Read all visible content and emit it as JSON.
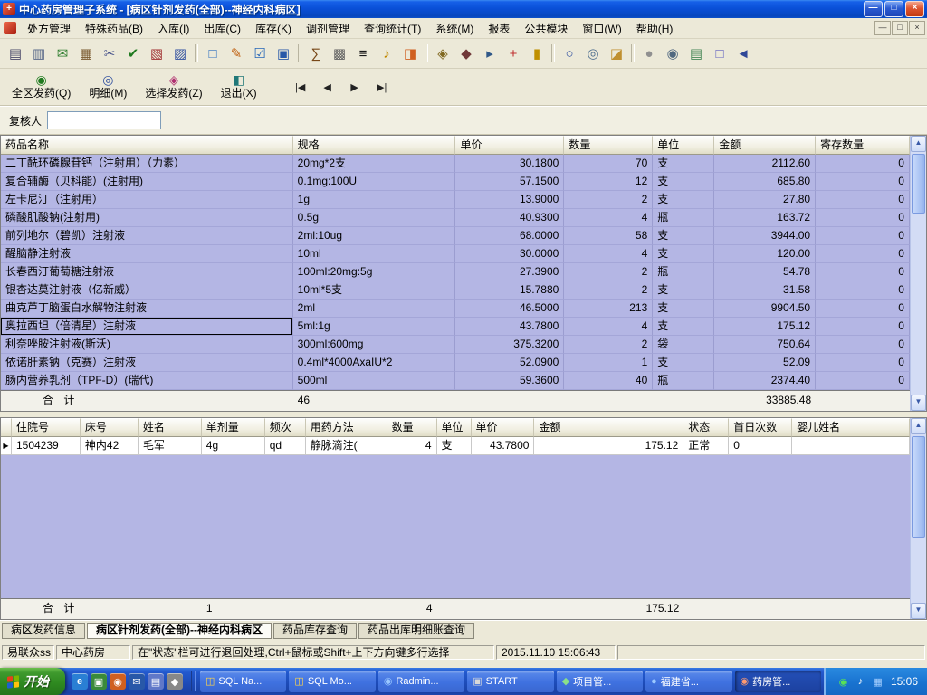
{
  "window": {
    "title": "中心药房管理子系统 - [病区针剂发药(全部)--神经内科病区]",
    "minimize": "—",
    "maximize": "□",
    "close": "×"
  },
  "menubar": {
    "items": [
      "处方管理",
      "特殊药品(B)",
      "入库(I)",
      "出库(C)",
      "库存(K)",
      "调剂管理",
      "查询统计(T)",
      "系统(M)",
      "报表",
      "公共模块",
      "窗口(W)",
      "帮助(H)"
    ],
    "mdi": {
      "minimize": "—",
      "restore": "□",
      "close": "×"
    }
  },
  "toolbar": {
    "groups": [
      [
        {
          "name": "printer-icon",
          "glyph": "▤",
          "color": "#4a4a6a"
        },
        {
          "name": "print-preview-icon",
          "glyph": "▥",
          "color": "#5a6a8a"
        },
        {
          "name": "mail-send-icon",
          "glyph": "✉",
          "color": "#2d7d2d"
        },
        {
          "name": "ledger-icon",
          "glyph": "▦",
          "color": "#7a5a30"
        },
        {
          "name": "scissors-icon",
          "glyph": "✂",
          "color": "#44508a"
        },
        {
          "name": "approve-icon",
          "glyph": "✔",
          "color": "#1f7a1f"
        },
        {
          "name": "red-ledger-icon",
          "glyph": "▧",
          "color": "#a03030"
        },
        {
          "name": "blue-ledger-icon",
          "glyph": "▨",
          "color": "#3050a0"
        }
      ],
      [
        {
          "name": "doc-new-icon",
          "glyph": "□",
          "color": "#3070c0"
        },
        {
          "name": "doc-edit-icon",
          "glyph": "✎",
          "color": "#c06010"
        },
        {
          "name": "doc-audit-icon",
          "glyph": "☑",
          "color": "#2868b8"
        },
        {
          "name": "doc-save-icon",
          "glyph": "▣",
          "color": "#2858a8"
        }
      ],
      [
        {
          "name": "sum-report-icon",
          "glyph": "∑",
          "color": "#784818"
        },
        {
          "name": "report-grid-icon",
          "glyph": "▩",
          "color": "#606060"
        },
        {
          "name": "barcode-icon",
          "glyph": "≡",
          "color": "#181818"
        },
        {
          "name": "alarm-icon",
          "glyph": "♪",
          "color": "#c08800"
        },
        {
          "name": "orange-panel-icon",
          "glyph": "◨",
          "color": "#d06020"
        }
      ],
      [
        {
          "name": "key-icon",
          "glyph": "◈",
          "color": "#806820"
        },
        {
          "name": "lock-icon",
          "glyph": "◆",
          "color": "#703838"
        },
        {
          "name": "transport-icon",
          "glyph": "▸",
          "color": "#305888"
        },
        {
          "name": "medicine-box-icon",
          "glyph": "+",
          "color": "#c03030"
        },
        {
          "name": "thermometer-icon",
          "glyph": "▮",
          "color": "#c09000"
        }
      ],
      [
        {
          "name": "search-icon",
          "glyph": "○",
          "color": "#3050a0"
        },
        {
          "name": "zoom-grid-icon",
          "glyph": "◎",
          "color": "#507090"
        },
        {
          "name": "folder-open-icon",
          "glyph": "◪",
          "color": "#c09030"
        }
      ],
      [
        {
          "name": "globe-icon",
          "glyph": "●",
          "color": "#909090"
        },
        {
          "name": "magnifier-icon",
          "glyph": "◉",
          "color": "#506880"
        },
        {
          "name": "layout-icon",
          "glyph": "▤",
          "color": "#488858"
        },
        {
          "name": "export-icon",
          "glyph": "□",
          "color": "#6060c0"
        },
        {
          "name": "back-icon",
          "glyph": "◄",
          "color": "#304898"
        }
      ]
    ]
  },
  "actionbar": {
    "buttons": [
      {
        "name": "dispense-all-button",
        "icon": "pills-icon",
        "glyph": "◉",
        "color": "#1f7a1f",
        "label": "全区发药(Q)"
      },
      {
        "name": "detail-button",
        "icon": "detail-magnifier-icon",
        "glyph": "◎",
        "color": "#3050a0",
        "label": "明细(M)"
      },
      {
        "name": "select-dispense-button",
        "icon": "select-pills-icon",
        "glyph": "◈",
        "color": "#b03070",
        "label": "选择发药(Z)"
      },
      {
        "name": "exit-button",
        "icon": "exit-door-icon",
        "glyph": "◧",
        "color": "#207878",
        "label": "退出(X)"
      }
    ],
    "nav": [
      {
        "name": "nav-first-button",
        "glyph": "|◀"
      },
      {
        "name": "nav-prev-button",
        "glyph": "◀"
      },
      {
        "name": "nav-next-button",
        "glyph": "▶"
      },
      {
        "name": "nav-last-button",
        "glyph": "▶|"
      }
    ]
  },
  "reviewer": {
    "label": "复核人",
    "value": ""
  },
  "main_table": {
    "columns": [
      "药品名称",
      "规格",
      "单价",
      "数量",
      "单位",
      "金额",
      "寄存数量"
    ],
    "rows": [
      [
        "二丁酰环磷腺苷钙（注射用）（力素）",
        "20mg*2支",
        "30.1800",
        "70",
        "支",
        "2112.60",
        "0"
      ],
      [
        "复合辅酶（贝科能）(注射用)",
        "0.1mg:100U",
        "57.1500",
        "12",
        "支",
        "685.80",
        "0"
      ],
      [
        "左卡尼汀（注射用）",
        "1g",
        "13.9000",
        "2",
        "支",
        "27.80",
        "0"
      ],
      [
        "磷酸肌酸钠(注射用)",
        "0.5g",
        "40.9300",
        "4",
        "瓶",
        "163.72",
        "0"
      ],
      [
        "前列地尔（碧凯）注射液",
        "2ml:10ug",
        "68.0000",
        "58",
        "支",
        "3944.00",
        "0"
      ],
      [
        "醒脑静注射液",
        "10ml",
        "30.0000",
        "4",
        "支",
        "120.00",
        "0"
      ],
      [
        "长春西汀葡萄糖注射液",
        "100ml:20mg:5g",
        "27.3900",
        "2",
        "瓶",
        "54.78",
        "0"
      ],
      [
        "银杏达莫注射液（亿新威）",
        "10ml*5支",
        "15.7880",
        "2",
        "支",
        "31.58",
        "0"
      ],
      [
        "曲克芦丁脑蛋白水解物注射液",
        "2ml",
        "46.5000",
        "213",
        "支",
        "9904.50",
        "0"
      ],
      [
        "奥拉西坦（倍清星）注射液",
        "5ml:1g",
        "43.7800",
        "4",
        "支",
        "175.12",
        "0"
      ],
      [
        "利奈唑胺注射液(斯沃)",
        "300ml:600mg",
        "375.3200",
        "2",
        "袋",
        "750.64",
        "0"
      ],
      [
        "依诺肝素钠（克赛）注射液",
        "0.4ml*4000AxaIU*2",
        "52.0900",
        "1",
        "支",
        "52.09",
        "0"
      ],
      [
        "肠内营养乳剂（TPF-D）(瑞代)",
        "500ml",
        "59.3600",
        "40",
        "瓶",
        "2374.40",
        "0"
      ]
    ],
    "selected_index": 9,
    "total": {
      "label": "合  计",
      "count": "46",
      "amount": "33885.48"
    }
  },
  "detail_table": {
    "columns": [
      "住院号",
      "床号",
      "姓名",
      "单剂量",
      "频次",
      "用药方法",
      "数量",
      "单位",
      "单价",
      "金额",
      "状态",
      "首日次数",
      "婴儿姓名"
    ],
    "current_row_marker": "▶",
    "rows": [
      [
        "1504239",
        "神内42",
        "毛军",
        "4g",
        "qd",
        "静脉滴注(",
        "4",
        "支",
        "43.7800",
        "175.12",
        "正常",
        "0",
        ""
      ]
    ],
    "total": {
      "label": "合  计",
      "dose_count": "1",
      "qty": "4",
      "amount": "175.12"
    }
  },
  "bottom_tabs": {
    "active_index": 1,
    "tabs": [
      "病区发药信息",
      "病区针剂发药(全部)--神经内科病区",
      "药品库存查询",
      "药品出库明细账查询"
    ]
  },
  "statusbar": {
    "user": "易联众ss",
    "dept": "中心药房",
    "hint": "在\"状态\"栏可进行退回处理,Ctrl+鼠标或Shift+上下方向键多行选择",
    "timestamp": "2015.11.10 15:06:43"
  },
  "taskbar": {
    "start_label": "开始",
    "quicklaunch": [
      {
        "name": "quicklaunch-ie-icon",
        "glyph": "e",
        "color": "#ffffff",
        "bg": "#2a7fd4"
      },
      {
        "name": "quicklaunch-desktop-icon",
        "glyph": "▣",
        "color": "#ffffff",
        "bg": "#3a8a3a"
      },
      {
        "name": "quicklaunch-media-icon",
        "glyph": "◉",
        "color": "#ffffff",
        "bg": "#d06020"
      },
      {
        "name": "quicklaunch-mail-icon",
        "glyph": "✉",
        "color": "#ffffff",
        "bg": "#2858a8"
      },
      {
        "name": "quicklaunch-doc-icon",
        "glyph": "▤",
        "color": "#ffffff",
        "bg": "#6078c8"
      },
      {
        "name": "quicklaunch-tools-icon",
        "glyph": "◆",
        "color": "#ffffff",
        "bg": "#888888"
      }
    ],
    "tasks": [
      {
        "name": "task-button-sql-na",
        "label": "SQL Na...",
        "glyph": "◫",
        "color": "#ffd54a",
        "active": false
      },
      {
        "name": "task-button-sql-mo",
        "label": "SQL Mo...",
        "glyph": "◫",
        "color": "#ffd54a",
        "active": false
      },
      {
        "name": "task-button-radmin",
        "label": "Radmin...",
        "glyph": "◉",
        "color": "#9ac8ff",
        "active": false
      },
      {
        "name": "task-button-start",
        "label": "START",
        "glyph": "▣",
        "color": "#d8d8d8",
        "active": false
      },
      {
        "name": "task-button-project",
        "label": "项目管...",
        "glyph": "◆",
        "color": "#8ae08a",
        "active": false
      },
      {
        "name": "task-button-fujian",
        "label": "福建省...",
        "glyph": "●",
        "color": "#9ac8ff",
        "active": false
      },
      {
        "name": "task-button-pharmacy",
        "label": "药房管...",
        "glyph": "◉",
        "color": "#ff9a70",
        "active": true
      }
    ],
    "tray_icons": [
      {
        "name": "tray-shield-icon",
        "glyph": "◉",
        "color": "#58e058"
      },
      {
        "name": "tray-volume-icon",
        "glyph": "♪",
        "color": "#ffffff"
      },
      {
        "name": "tray-network-icon",
        "glyph": "▦",
        "color": "#a8d0ff"
      }
    ],
    "time": "15:06"
  }
}
